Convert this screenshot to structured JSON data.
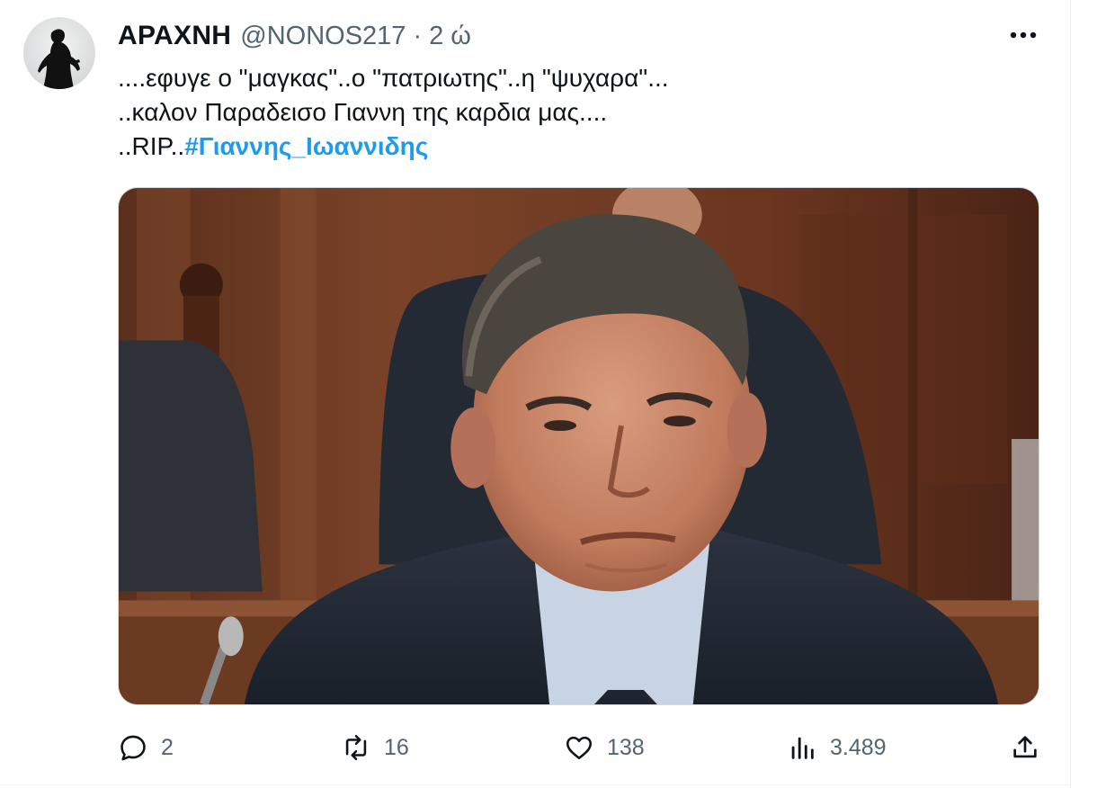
{
  "tweet": {
    "author": {
      "name": "ΑΡΑΧΝΗ",
      "handle": "@NONOS217",
      "avatar_icon": "silhouette-avatar"
    },
    "separator": "·",
    "time": "2 ώ",
    "lines": [
      "....εφυγε ο \"μαγκας\"..ο \"πατριωτης\"..η \"ψυχαρα\"...",
      "..καλον Παραδεισο Γιαννη της καρδια μας...."
    ],
    "last_line_prefix": "..RIP..",
    "hashtag": "#Γιαννης_Ιωαννιδης",
    "more_icon": "more-horizontal-icon",
    "media": {
      "type": "photo",
      "description_icon": "photo-of-man-in-suit"
    },
    "actions": {
      "replies": "2",
      "retweets": "16",
      "likes": "138",
      "views": "3.489"
    }
  },
  "colors": {
    "text": "#0f1419",
    "secondary": "#536471",
    "link": "#1d9bf0",
    "border": "#cfd9de"
  }
}
